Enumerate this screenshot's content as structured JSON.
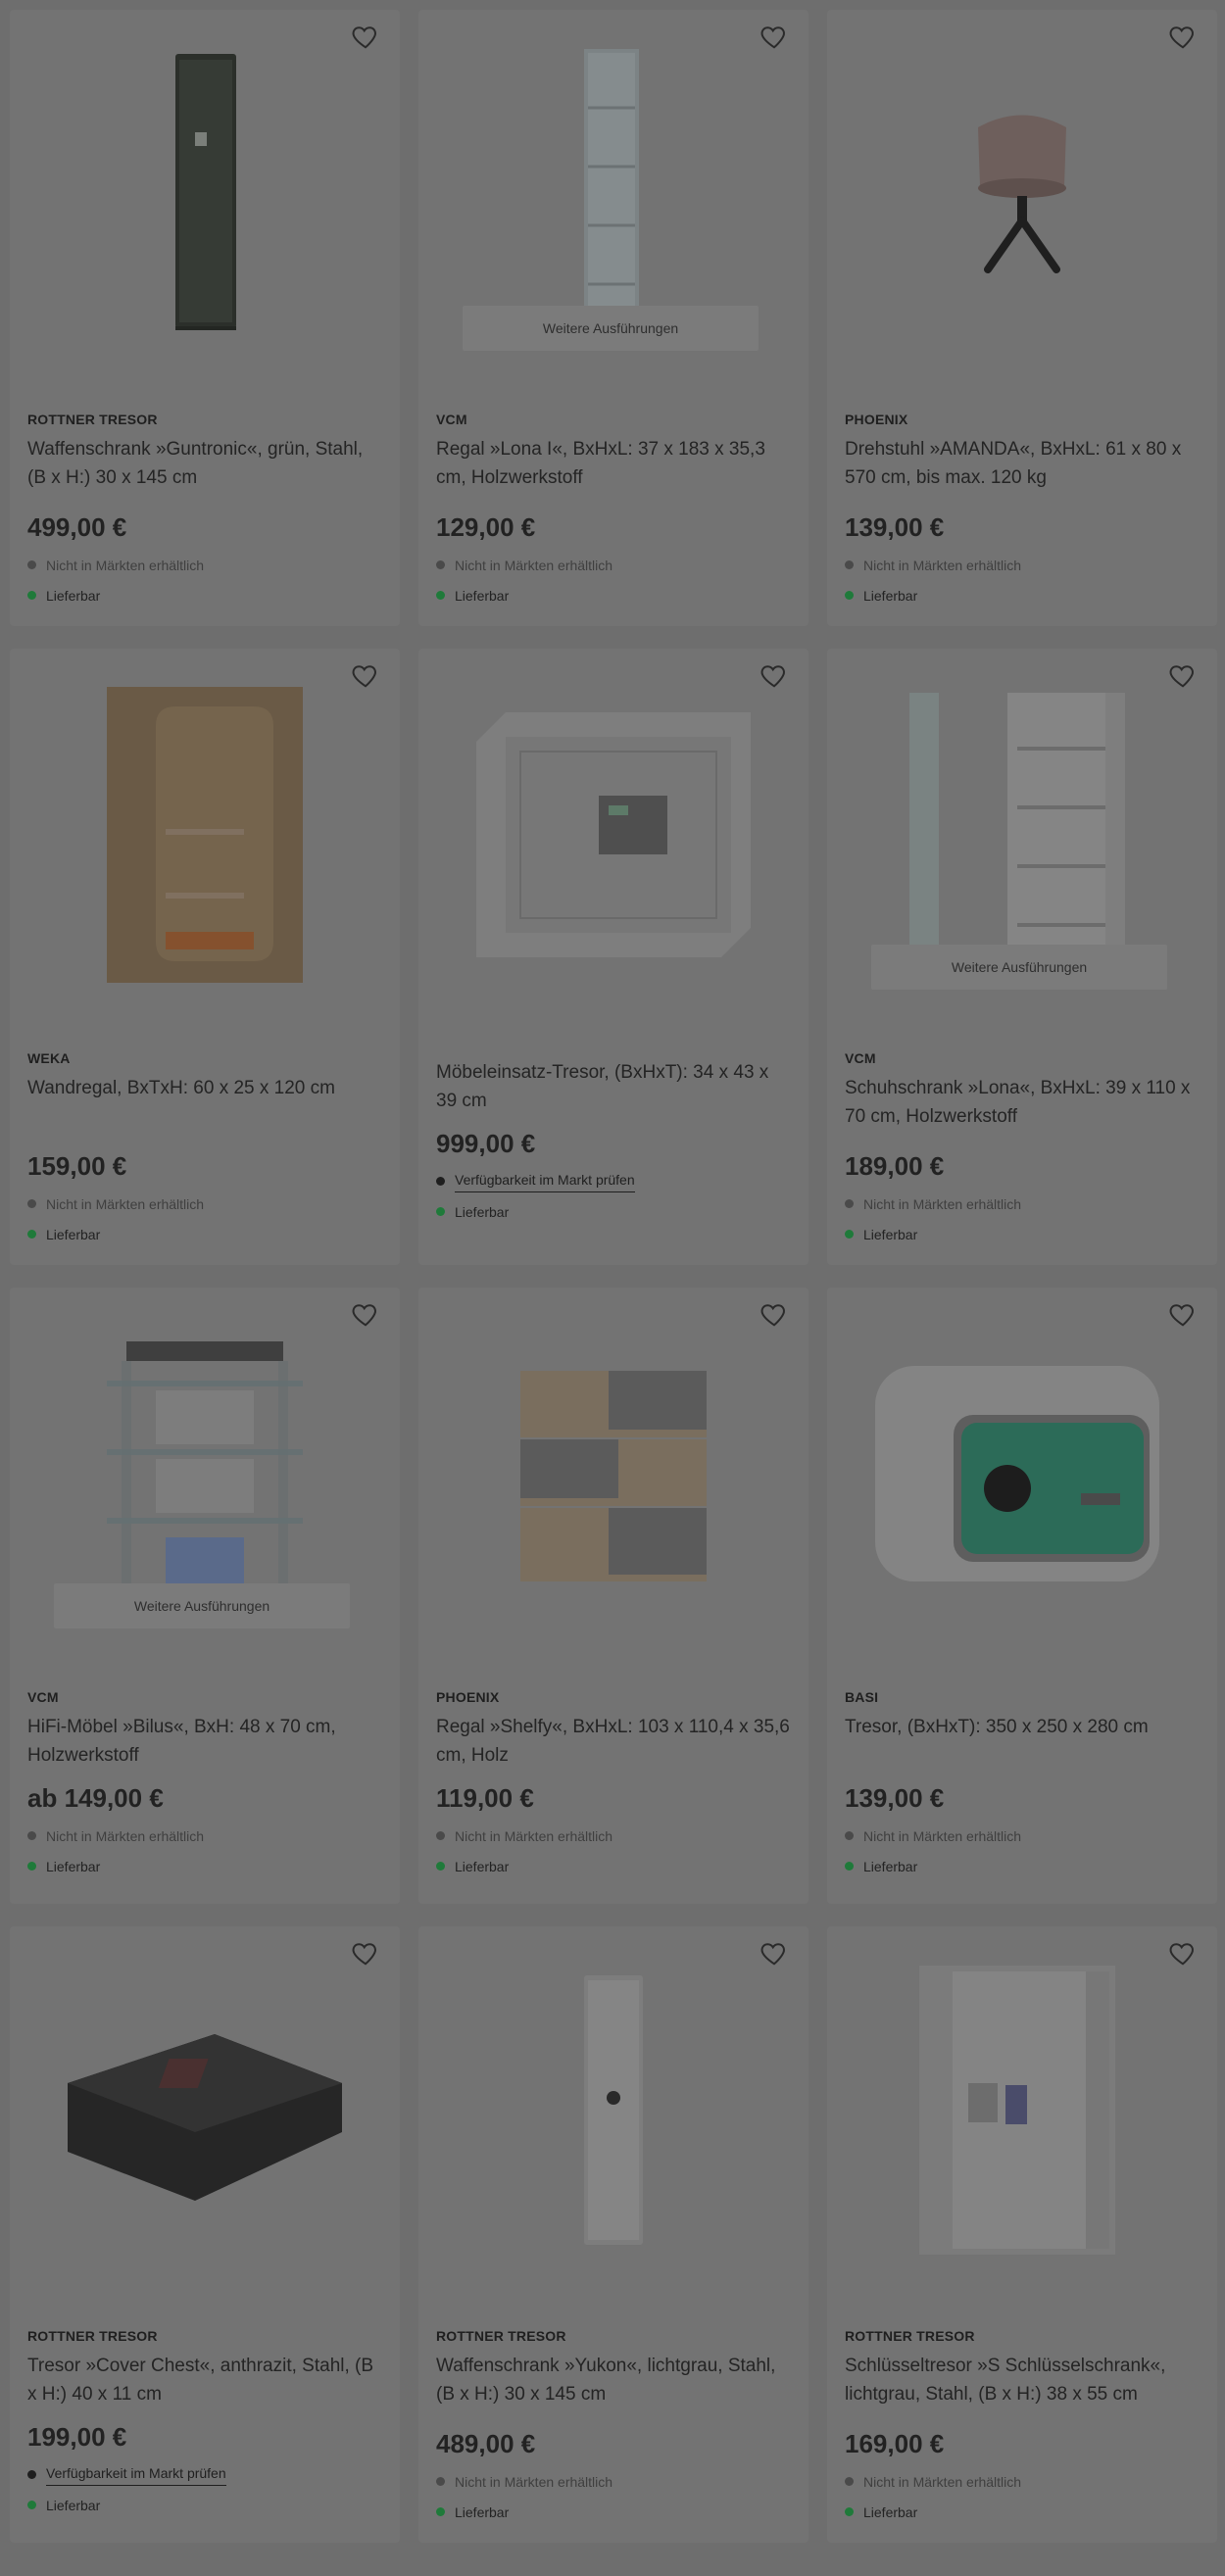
{
  "products": [
    {
      "brand": "ROTTNER TRESOR",
      "title": "Waffenschrank »Guntronic«, grün, Stahl, (B x H:) 30 x 145 cm",
      "price": "499,00 €",
      "store": "Nicht in Märkten erhältlich",
      "delivery": "Lieferbar",
      "variants": "",
      "image": "gun-safe-green"
    },
    {
      "brand": "VCM",
      "title": "Regal »Lona I«, BxHxL: 37 x 183 x 35,3 cm, Holzwerkstoff",
      "price": "129,00 €",
      "store": "Nicht in Märkten erhältlich",
      "delivery": "Lieferbar",
      "variants": "Weitere Ausführungen",
      "image": "tall-shelf-white"
    },
    {
      "brand": "PHOENIX",
      "title": "Drehstuhl »AMANDA«, BxHxL: 61 x 80 x 570 cm, bis max. 120 kg",
      "price": "139,00 €",
      "store": "Nicht in Märkten erhältlich",
      "delivery": "Lieferbar",
      "variants": "",
      "image": "swivel-chair"
    },
    {
      "brand": "WEKA",
      "title": "Wandregal, BxTxH: 60 x 25 x 120 cm",
      "price": "159,00 €",
      "store": "Nicht in Märkten erhältlich",
      "delivery": "Lieferbar",
      "variants": "",
      "image": "wall-shelf-wood"
    },
    {
      "brand": "",
      "title": "Möbeleinsatz-Tresor, (BxHxT): 34 x 43 x 39 cm",
      "price": "999,00 €",
      "store": "Verfügbarkeit im Markt prüfen",
      "delivery": "Lieferbar",
      "variants": "",
      "image": "furniture-safe"
    },
    {
      "brand": "VCM",
      "title": "Schuhschrank »Lona«, BxHxL: 39 x 110 x 70 cm, Holzwerkstoff",
      "price": "189,00 €",
      "store": "Nicht in Märkten erhältlich",
      "delivery": "Lieferbar",
      "variants": "Weitere Ausführungen",
      "image": "shoe-cabinet"
    },
    {
      "brand": "VCM",
      "title": "HiFi-Möbel »Bilus«, BxH: 48 x 70 cm, Holzwerkstoff",
      "price": "ab 149,00 €",
      "store": "Nicht in Märkten erhältlich",
      "delivery": "Lieferbar",
      "variants": "Weitere Ausführungen",
      "image": "hifi-rack"
    },
    {
      "brand": "PHOENIX",
      "title": "Regal »Shelfy«, BxHxL: 103 x 110,4 x 35,6 cm, Holz",
      "price": "119,00 €",
      "store": "Nicht in Märkten erhältlich",
      "delivery": "Lieferbar",
      "variants": "",
      "image": "shelfy-shelf"
    },
    {
      "brand": "BASI",
      "title": "Tresor, (BxHxT): 350 x 250 x 280 cm",
      "price": "139,00 €",
      "store": "Nicht in Märkten erhältlich",
      "delivery": "Lieferbar",
      "variants": "",
      "image": "green-safe"
    },
    {
      "brand": "ROTTNER TRESOR",
      "title": "Tresor »Cover Chest«, anthrazit, Stahl, (B x H:) 40 x 11 cm",
      "price": "199,00 €",
      "store": "Verfügbarkeit im Markt prüfen",
      "delivery": "Lieferbar",
      "variants": "",
      "image": "cover-chest"
    },
    {
      "brand": "ROTTNER TRESOR",
      "title": "Waffenschrank »Yukon«, lichtgrau, Stahl, (B x H:) 30 x 145 cm",
      "price": "489,00 €",
      "store": "Nicht in Märkten erhältlich",
      "delivery": "Lieferbar",
      "variants": "",
      "image": "gun-safe-grey"
    },
    {
      "brand": "ROTTNER TRESOR",
      "title": "Schlüsseltresor »S Schlüsselschrank«, lichtgrau, Stahl, (B x H:) 38 x 55 cm",
      "price": "169,00 €",
      "store": "Nicht in Märkten erhältlich",
      "delivery": "Lieferbar",
      "variants": "",
      "image": "key-cabinet"
    }
  ]
}
